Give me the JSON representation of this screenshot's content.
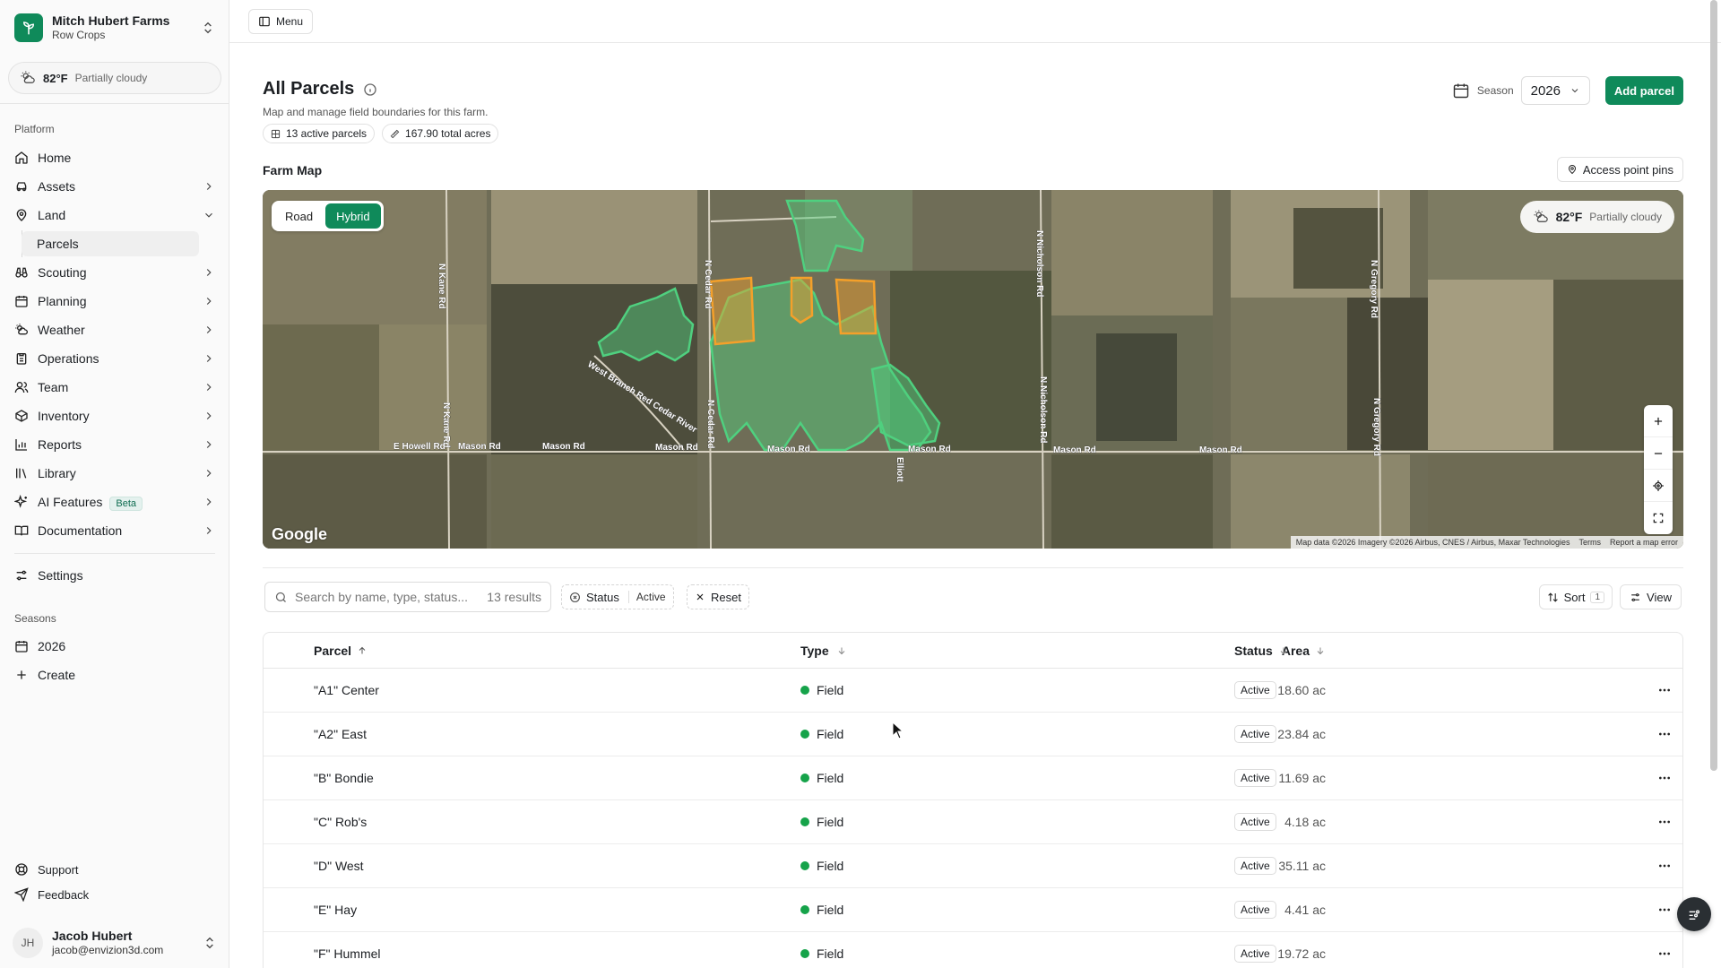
{
  "org": {
    "name": "Mitch Hubert Farms",
    "subtitle": "Row Crops"
  },
  "sidebar_weather": {
    "temp": "82°F",
    "condition": "Partially cloudy"
  },
  "sidebar": {
    "platform_label": "Platform",
    "items": [
      {
        "label": "Home",
        "icon": "home-icon"
      },
      {
        "label": "Assets",
        "icon": "car-icon"
      },
      {
        "label": "Land",
        "icon": "map-pin-icon"
      },
      {
        "label": "Parcels"
      },
      {
        "label": "Scouting",
        "icon": "binoculars-icon"
      },
      {
        "label": "Planning",
        "icon": "calendar-icon"
      },
      {
        "label": "Weather",
        "icon": "sun-cloud-icon"
      },
      {
        "label": "Operations",
        "icon": "clipboard-icon"
      },
      {
        "label": "Team",
        "icon": "users-icon"
      },
      {
        "label": "Inventory",
        "icon": "box-icon"
      },
      {
        "label": "Reports",
        "icon": "bar-chart-icon"
      },
      {
        "label": "Library",
        "icon": "library-icon"
      },
      {
        "label": "AI Features",
        "icon": "sparkles-icon",
        "badge": "Beta"
      },
      {
        "label": "Documentation",
        "icon": "book-icon"
      }
    ],
    "settings_label": "Settings",
    "seasons_label": "Seasons",
    "season_item": "2026",
    "create_label": "Create",
    "support_label": "Support",
    "feedback_label": "Feedback"
  },
  "user": {
    "initials": "JH",
    "name": "Jacob Hubert",
    "email": "jacob@envizion3d.com"
  },
  "topbar": {
    "menu_label": "Menu"
  },
  "page": {
    "title": "All Parcels",
    "description": "Map and manage field boundaries for this farm.",
    "chips": {
      "active": "13 active parcels",
      "acres": "167.90 total acres"
    },
    "season_label": "Season",
    "season_value": "2026",
    "add_button": "Add parcel"
  },
  "map": {
    "section_title": "Farm Map",
    "access_button": "Access point pins",
    "toggle": {
      "road": "Road",
      "hybrid": "Hybrid",
      "selected": "Hybrid"
    },
    "weather": {
      "temp": "82°F",
      "condition": "Partially cloudy"
    },
    "google_logo": "Google",
    "attribution": {
      "data": "Map data ©2026 Imagery ©2026 Airbus, CNES / Airbus, Maxar Technologies",
      "terms": "Terms",
      "report": "Report a map error"
    },
    "road_labels": {
      "n_kane": "N Kane Rd",
      "n_cedar": "N Cedar Rd",
      "n_nicholson": "N Nicholson Rd",
      "n_gregory": "N Gregory Rd",
      "e_howell": "E Howell Rd",
      "mason": "Mason Rd",
      "river": "West Branch Red Cedar River",
      "elliott": "Elliott"
    },
    "colors": {
      "field_green": "#4fd07f",
      "field_orange": "#f4a02a"
    }
  },
  "filters": {
    "search_placeholder": "Search by name, type, status...",
    "result_count": "13 results",
    "status_label": "Status",
    "status_value": "Active",
    "reset_label": "Reset",
    "sort_label": "Sort",
    "sort_count": "1",
    "view_label": "View"
  },
  "table": {
    "headers": {
      "parcel": "Parcel",
      "type": "Type",
      "area": "Area",
      "status": "Status"
    },
    "rows": [
      {
        "parcel": "\"A1\" Center",
        "type": "Field",
        "area": "18.60 ac",
        "status": "Active"
      },
      {
        "parcel": "\"A2\" East",
        "type": "Field",
        "area": "23.84 ac",
        "status": "Active"
      },
      {
        "parcel": "\"B\" Bondie",
        "type": "Field",
        "area": "11.69 ac",
        "status": "Active"
      },
      {
        "parcel": "\"C\" Rob's",
        "type": "Field",
        "area": "4.18 ac",
        "status": "Active"
      },
      {
        "parcel": "\"D\" West",
        "type": "Field",
        "area": "35.11 ac",
        "status": "Active"
      },
      {
        "parcel": "\"E\" Hay",
        "type": "Field",
        "area": "4.41 ac",
        "status": "Active"
      },
      {
        "parcel": "\"F\" Hummel",
        "type": "Field",
        "area": "19.72 ac",
        "status": "Active"
      }
    ]
  },
  "colors": {
    "accent": "#0f8a5a",
    "status_green": "#16a34a"
  }
}
